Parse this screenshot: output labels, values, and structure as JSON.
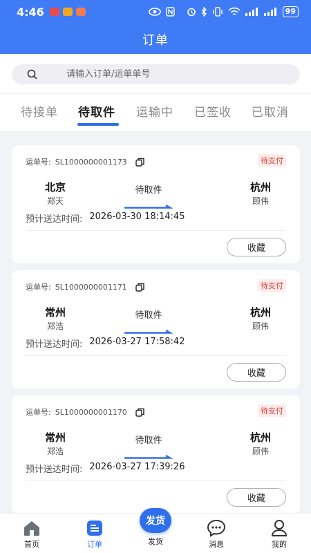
{
  "status_bar": {
    "time": "4:46",
    "battery": "99",
    "colors": {
      "app1": "#e84b4b",
      "app2": "#f5a623",
      "app3": "#f07c56"
    }
  },
  "header": {
    "title": "订单"
  },
  "search": {
    "placeholder": "请输入订单/运单单号",
    "value": ""
  },
  "tabs": [
    {
      "label": "待接单",
      "active": false
    },
    {
      "label": "待取件",
      "active": true
    },
    {
      "label": "运输中",
      "active": false
    },
    {
      "label": "已签收",
      "active": false
    },
    {
      "label": "已取消",
      "active": false
    }
  ],
  "orders": [
    {
      "waybill_label": "运单号:",
      "waybill_no": "SL1000000001173",
      "badge": "待支付",
      "from_city": "北京",
      "from_person": "郑天",
      "status": "待取件",
      "to_city": "杭州",
      "to_person": "顾伟",
      "eta_label": "预计送达时间:",
      "eta": "2026-03-30 18:14:45",
      "fav_label": "收藏"
    },
    {
      "waybill_label": "运单号:",
      "waybill_no": "SL1000000001171",
      "badge": "待支付",
      "from_city": "常州",
      "from_person": "郑浩",
      "status": "待取件",
      "to_city": "杭州",
      "to_person": "顾伟",
      "eta_label": "预计送达时间:",
      "eta": "2026-03-27 17:58:42",
      "fav_label": "收藏"
    },
    {
      "waybill_label": "运单号:",
      "waybill_no": "SL1000000001170",
      "badge": "待支付",
      "from_city": "常州",
      "from_person": "郑浩",
      "status": "待取件",
      "to_city": "杭州",
      "to_person": "顾伟",
      "eta_label": "预计送达时间:",
      "eta": "2026-03-27 17:39:26",
      "fav_label": "收藏"
    }
  ],
  "bottom_nav": {
    "home": "首页",
    "orders": "订单",
    "ship_button": "发货",
    "ship": "发货",
    "messages": "消息",
    "mine": "我的"
  },
  "colors": {
    "brand": "#3f7bf5",
    "accent": "#2f6fec",
    "badge": "#e0403a"
  },
  "icons": [
    "search-icon",
    "copy-icon",
    "home-icon",
    "orders-icon",
    "message-icon",
    "user-icon",
    "wifi-icon",
    "signal-icon",
    "bluetooth-icon",
    "eye-icon",
    "alarm-icon",
    "nfc-icon"
  ]
}
